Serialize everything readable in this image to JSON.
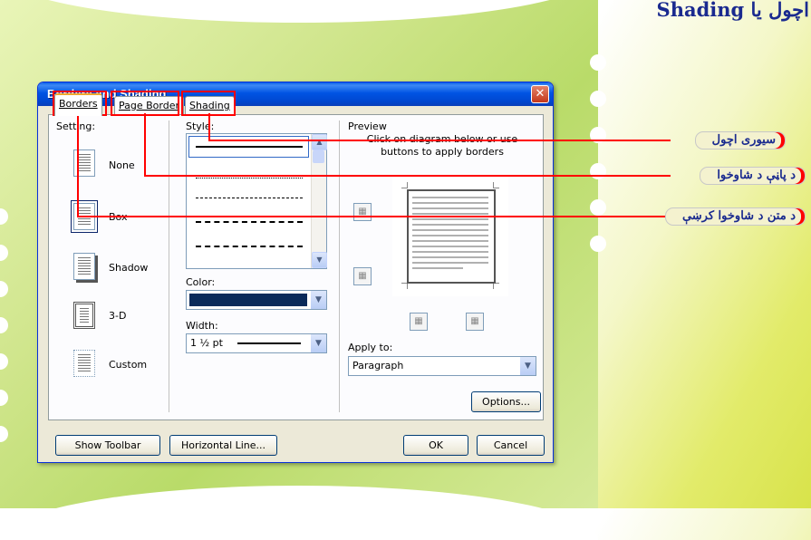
{
  "slide": {
    "title": "اچول يا Shading"
  },
  "dialog": {
    "title": "Borders and Shading",
    "close_glyph": "✕",
    "tabs": [
      {
        "label": "Borders",
        "active": true
      },
      {
        "label": "Page Border",
        "active": false
      },
      {
        "label": "Shading",
        "active": false
      }
    ],
    "setting": {
      "label": "Setting:",
      "items": [
        {
          "label": "None"
        },
        {
          "label": "Box"
        },
        {
          "label": "Shadow"
        },
        {
          "label": "3-D"
        },
        {
          "label": "Custom"
        }
      ]
    },
    "style": {
      "label": "Style:"
    },
    "color": {
      "label": "Color:",
      "value_color": "#0a2a5a"
    },
    "width": {
      "label": "Width:",
      "value": "1 ½ pt"
    },
    "preview": {
      "label": "Preview",
      "hint": "Click on diagram below or use buttons to apply borders"
    },
    "apply_to": {
      "label": "Apply to:",
      "value": "Paragraph"
    },
    "buttons": {
      "options": "Options...",
      "show_toolbar": "Show Toolbar",
      "horizontal_line": "Horizontal Line...",
      "ok": "OK",
      "cancel": "Cancel"
    }
  },
  "callouts": [
    {
      "text": "سيورى اچول"
    },
    {
      "text": "د پاڼې د شاوخوا"
    },
    {
      "text": "د متن د شاوخوا كرښې"
    }
  ],
  "colors": {
    "annotation": "#ff0000",
    "accent_title": "#1a2a8f",
    "titlebar": "#0054e3"
  }
}
